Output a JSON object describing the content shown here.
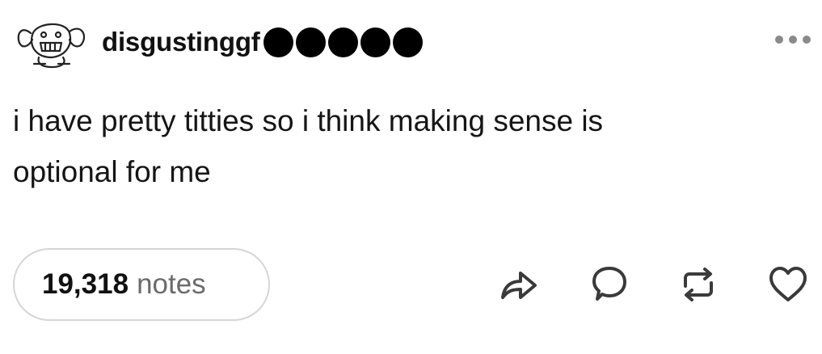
{
  "post": {
    "username": "disgustinggf",
    "badge_dots": 5,
    "more_icon": "more-dots-icon",
    "body_lines": [
      "i have pretty titties so i think making sense is",
      "optional for me"
    ],
    "notes_count": "19,318",
    "notes_label": "notes",
    "actions": [
      {
        "name": "share-button",
        "icon": "share-icon"
      },
      {
        "name": "reply-button",
        "icon": "reply-bubble-icon"
      },
      {
        "name": "reblog-button",
        "icon": "reblog-icon"
      },
      {
        "name": "like-button",
        "icon": "heart-icon"
      }
    ]
  },
  "colors": {
    "text": "#111111",
    "muted": "#6b6b6b",
    "border": "#d6d6d6",
    "background": "#ffffff"
  }
}
